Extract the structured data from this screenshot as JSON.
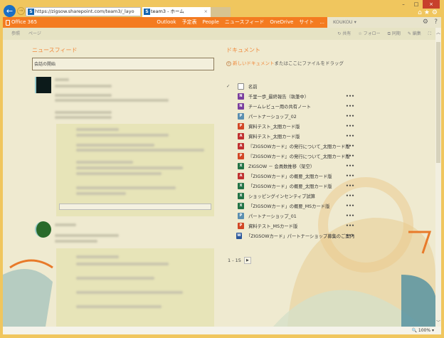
{
  "browser": {
    "address": "https://zigsow.sharepoint.com/team3/_layo",
    "address_domain": "sharepoint.com",
    "tab_title": "team3 - ホーム",
    "zoom": "100%"
  },
  "suite_bar": {
    "brand": "Office 365",
    "nav": [
      "Outlook",
      "予定表",
      "People",
      "ニュースフィード",
      "OneDrive",
      "サイト",
      "..."
    ],
    "user": "KOUKOU"
  },
  "ribbon": {
    "left": [
      "参照",
      "ページ"
    ],
    "right": [
      "共有",
      "フォロー",
      "同期",
      "編集"
    ]
  },
  "newsfeed": {
    "title": "ニュースフィード",
    "compose_placeholder": "会話の開始"
  },
  "documents": {
    "title": "ドキュメント",
    "new_prefix": "新しいドキュメント",
    "new_suffix": "またはここにファイルをドラッグ",
    "column_name": "名前",
    "items": [
      {
        "name": "千里一歩_最終報告（執筆中）",
        "type": "onenote",
        "color": "#7b3f9e"
      },
      {
        "name": "チームレビュー用の共有ノート",
        "type": "onenote",
        "color": "#7b3f9e"
      },
      {
        "name": "パートナーショップ_02",
        "type": "publisher",
        "color": "#5b8fb0"
      },
      {
        "name": "資料テスト_太間カード版",
        "type": "powerpoint",
        "color": "#d24726"
      },
      {
        "name": "資料テスト_太間カード版",
        "type": "pdf",
        "color": "#c03030"
      },
      {
        "name": "『ZIGSOWカード』の発行について_太間カード版",
        "type": "pdf",
        "color": "#c03030"
      },
      {
        "name": "『ZIGSOWカード』の発行について_太間カード版",
        "type": "powerpoint",
        "color": "#d24726"
      },
      {
        "name": "ZIGSOW － 会員数推移（架空）",
        "type": "excel",
        "color": "#217346"
      },
      {
        "name": "「ZIGSOWカード」の概要_太間カード版",
        "type": "pdf",
        "color": "#c03030"
      },
      {
        "name": "「ZIGSOWカード」の概要_太間カード版",
        "type": "excel",
        "color": "#217346"
      },
      {
        "name": "ショッピングインセンティブ試算",
        "type": "excel",
        "color": "#217346"
      },
      {
        "name": "「ZIGSOWカード」の概要_MSカード版",
        "type": "excel",
        "color": "#217346"
      },
      {
        "name": "パートナーショップ_01",
        "type": "publisher",
        "color": "#5b8fb0"
      },
      {
        "name": "資料テスト_MSカード版",
        "type": "powerpoint",
        "color": "#d24726"
      },
      {
        "name": "「ZIGSOWカード」パートナーショップ募集のご案内",
        "type": "word",
        "color": "#2b579a"
      }
    ],
    "more_label": "•••",
    "pager": "1 - 15"
  },
  "colors": {
    "suite": "#f47b20",
    "accent": "#f0883a",
    "frame": "#f0c65e"
  }
}
